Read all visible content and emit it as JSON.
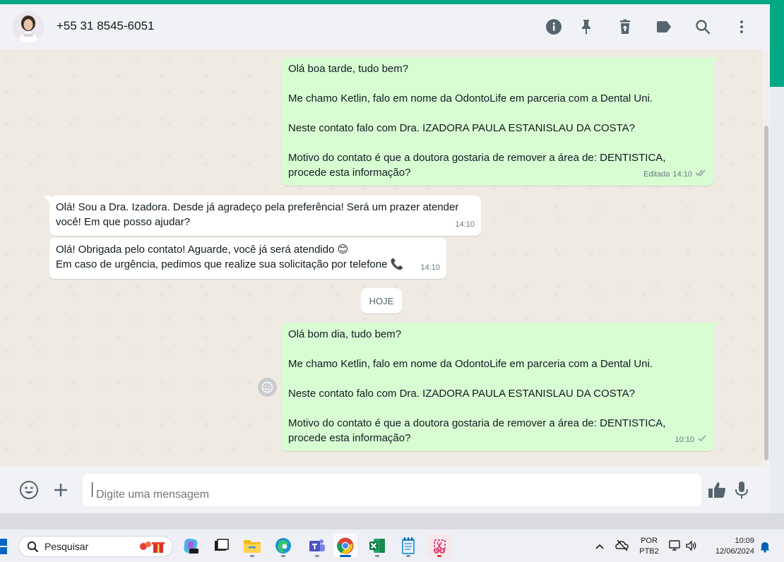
{
  "header": {
    "contact_name": "+55 31 8545-6051"
  },
  "messages": [
    {
      "direction": "out",
      "lines": [
        "Olá boa tarde, tudo bem?",
        "",
        "Me chamo Ketlin, falo em nome da OdontoLife em parceria com a Dental Uni.",
        "",
        "Neste contato falo com Dra. IZADORA PAULA ESTANISLAU DA COSTA?",
        "",
        "Motivo do contato é que a doutora gostaria de remover a área de: DENTISTICA,",
        "procede esta informação?"
      ],
      "edited_label": "Editada",
      "time": "14:10",
      "status": "double-check"
    },
    {
      "direction": "in",
      "lines": [
        "Olá! Sou a Dra. Izadora. Desde já agradeço pela preferência! Será um prazer atender",
        "você! Em que posso ajudar?"
      ],
      "time": "14:10"
    },
    {
      "direction": "in",
      "lines": [
        "Olá! Obrigada pelo contato! Aguarde, você já será atendido 😊",
        "Em caso de urgência, pedimos que realize sua solicitação por telefone 📞"
      ],
      "time": "14:10"
    },
    {
      "direction": "out",
      "lines": [
        "Olá bom dia, tudo bem?",
        "",
        "Me chamo Ketlin, falo em nome da OdontoLife em parceria com a Dental Uni.",
        "",
        "Neste contato falo com Dra. IZADORA PAULA ESTANISLAU DA COSTA?",
        "",
        "Motivo do contato é que a doutora gostaria de remover a área de: DENTISTICA,",
        "procede esta informação?"
      ],
      "time": "10:10",
      "status": "single-check"
    }
  ],
  "day_divider": "HOJE",
  "composer": {
    "placeholder": "Digite uma mensagem"
  },
  "taskbar": {
    "search_label": "Pesquisar",
    "language_line1": "POR",
    "language_line2": "PTB2",
    "clock_time": "10:09",
    "clock_date": "12/06/2024"
  },
  "icons": {
    "header": [
      "info-icon",
      "pin-icon",
      "delete-icon",
      "label-icon",
      "search-icon",
      "menu-icon"
    ],
    "composer": [
      "emoji-icon",
      "attach-icon",
      "thumbs-up-icon",
      "microphone-icon"
    ]
  },
  "colors": {
    "accent": "#00a884",
    "outgoing_bubble": "#d9fdd3",
    "incoming_bubble": "#ffffff",
    "chat_background": "#efeae2",
    "header_background": "#f0f2f5"
  }
}
